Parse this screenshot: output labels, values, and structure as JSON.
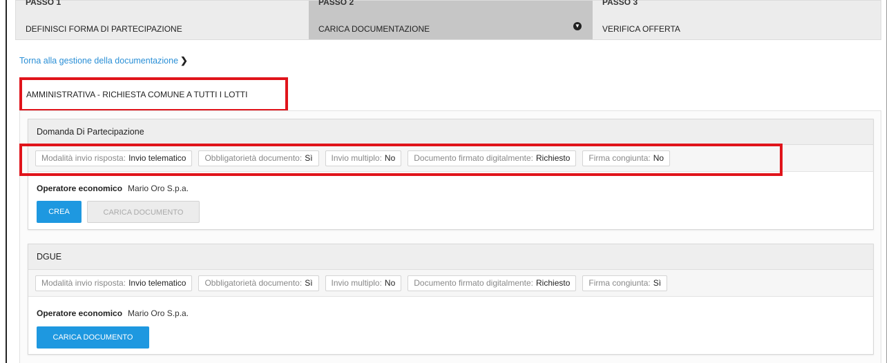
{
  "steps": [
    {
      "num": "PASSO 1",
      "name": "DEFINISCI FORMA DI PARTECIPAZIONE"
    },
    {
      "num": "PASSO 2",
      "name": "CARICA DOCUMENTAZIONE"
    },
    {
      "num": "PASSO 3",
      "name": "VERIFICA OFFERTA"
    }
  ],
  "active_step_icon": "chevron-down-circle-icon",
  "back_link": "Torna alla gestione della documentazione",
  "section_title": "AMMINISTRATIVA - RICHIESTA COMUNE A TUTTI I LOTTI",
  "cards": [
    {
      "title": "Domanda Di Partecipazione",
      "meta": [
        {
          "k": "Modalità invio risposta:",
          "v": "Invio telematico"
        },
        {
          "k": "Obbligatorietà documento:",
          "v": "Sì"
        },
        {
          "k": "Invio multiplo:",
          "v": "No"
        },
        {
          "k": "Documento firmato digitalmente:",
          "v": "Richiesto"
        },
        {
          "k": "Firma congiunta:",
          "v": "No"
        }
      ],
      "operator_label": "Operatore economico",
      "operator_value": "Mario Oro S.p.a.",
      "btn_create": "CREA",
      "btn_upload": "CARICA DOCUMENTO"
    },
    {
      "title": "DGUE",
      "meta": [
        {
          "k": "Modalità invio risposta:",
          "v": "Invio telematico"
        },
        {
          "k": "Obbligatorietà documento:",
          "v": "Sì"
        },
        {
          "k": "Invio multiplo:",
          "v": "No"
        },
        {
          "k": "Documento firmato digitalmente:",
          "v": "Richiesto"
        },
        {
          "k": "Firma congiunta:",
          "v": "Sì"
        }
      ],
      "operator_label": "Operatore economico",
      "operator_value": "Mario Oro S.p.a.",
      "btn_upload": "CARICA DOCUMENTO"
    }
  ],
  "colors": {
    "accent": "#1e98e0",
    "highlight": "#e0141b",
    "link": "#2a8fd6"
  }
}
